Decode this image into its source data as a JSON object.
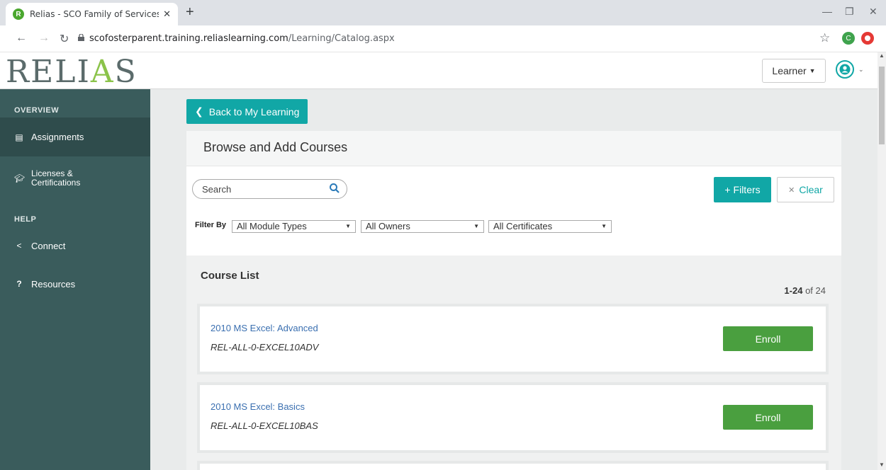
{
  "browser": {
    "tab_title": "Relias - SCO Family of Services Fo",
    "tab_favicon": "R",
    "url_host": "scofosterparent.training.reliaslearning.com",
    "url_path": "/Learning/Catalog.aspx",
    "profile_initial": "C"
  },
  "header": {
    "logo_text_1": "RELI",
    "logo_text_a": "A",
    "logo_text_2": "S",
    "role_button": "Learner"
  },
  "sidebar": {
    "section_overview": "OVERVIEW",
    "section_help": "HELP",
    "items": [
      {
        "label": "Assignments",
        "icon": "assignments-icon"
      },
      {
        "label": "Licenses &\nCertifications",
        "icon": "graduation-cap-icon"
      },
      {
        "label": "Connect",
        "icon": "share-icon"
      },
      {
        "label": "Resources",
        "icon": "question-icon"
      }
    ]
  },
  "main": {
    "back_button": "Back to My Learning",
    "panel_title": "Browse and Add Courses",
    "search_placeholder": "Search",
    "filters_button": "Filters",
    "clear_button": "Clear",
    "filter_by_label": "Filter By",
    "filters": [
      {
        "selected": "All Module Types"
      },
      {
        "selected": "All Owners"
      },
      {
        "selected": "All Certificates"
      }
    ],
    "course_list_title": "Course List",
    "count_range": "1-24",
    "count_of": "of 24",
    "courses": [
      {
        "title": "2010 MS Excel: Advanced",
        "code": "REL-ALL-0-EXCEL10ADV",
        "action": "Enroll"
      },
      {
        "title": "2010 MS Excel: Basics",
        "code": "REL-ALL-0-EXCEL10BAS",
        "action": "Enroll"
      }
    ]
  },
  "colors": {
    "sidebar_bg": "#3a5c5c",
    "teal_accent": "#11a7a6",
    "enroll_green": "#4a9f3f",
    "link_blue": "#3a6fb0"
  }
}
